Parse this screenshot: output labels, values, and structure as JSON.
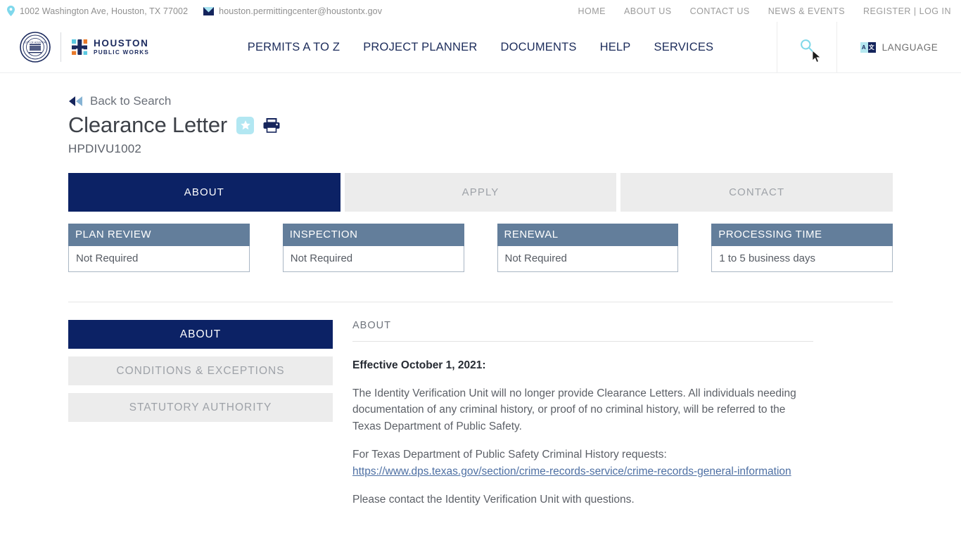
{
  "topbar": {
    "address": "1002 Washington Ave, Houston, TX 77002",
    "email": "houston.permittingcenter@houstontx.gov",
    "address_icon": "map-pin-icon",
    "email_icon": "envelope-icon",
    "links": [
      {
        "label": "HOME"
      },
      {
        "label": "ABOUT US"
      },
      {
        "label": "CONTACT US"
      },
      {
        "label": "NEWS & EVENTS"
      },
      {
        "label": "REGISTER | LOG IN"
      }
    ]
  },
  "header": {
    "seal_icon": "city-of-houston-seal-icon",
    "logo_mark_icon": "houston-public-works-mark-icon",
    "logo_line1": "HOUSTON",
    "logo_line2": "PUBLIC WORKS",
    "nav": [
      {
        "label": "PERMITS A TO Z"
      },
      {
        "label": "PROJECT PLANNER"
      },
      {
        "label": "DOCUMENTS"
      },
      {
        "label": "HELP"
      },
      {
        "label": "SERVICES"
      }
    ],
    "search_icon": "search-icon",
    "language_label": "LANGUAGE",
    "language_icon": "translate-icon",
    "language_icon_left_char": "A",
    "language_icon_right_char": "文"
  },
  "main": {
    "back_link": "Back to Search",
    "back_icon": "back-arrow-icon",
    "title": "Clearance Letter",
    "favorite_icon": "star-icon",
    "print_icon": "printer-icon",
    "permit_code": "HPDIVU1002",
    "tabs": [
      {
        "label": "ABOUT",
        "active": true
      },
      {
        "label": "APPLY",
        "active": false
      },
      {
        "label": "CONTACT",
        "active": false
      }
    ],
    "cards": [
      {
        "heading": "PLAN REVIEW",
        "value": "Not Required"
      },
      {
        "heading": "INSPECTION",
        "value": "Not Required"
      },
      {
        "heading": "RENEWAL",
        "value": "Not Required"
      },
      {
        "heading": "PROCESSING TIME",
        "value": "1 to 5 business days"
      }
    ],
    "side_nav": [
      {
        "label": "ABOUT",
        "active": true
      },
      {
        "label": "CONDITIONS & EXCEPTIONS",
        "active": false
      },
      {
        "label": "STATUTORY AUTHORITY",
        "active": false
      }
    ],
    "content": {
      "section_label": "ABOUT",
      "heading": "Effective October 1, 2021:",
      "paragraph1": "The Identity Verification Unit will no longer provide Clearance Letters. All individuals needing documentation of any criminal history, or proof of no criminal history, will be referred to the Texas Department of Public Safety.",
      "paragraph2_intro": "For Texas Department of Public Safety Criminal History requests:",
      "link_text": "https://www.dps.texas.gov/section/crime-records-service/crime-records-general-information",
      "paragraph3": "Please contact the Identity Verification Unit with questions."
    }
  },
  "colors": {
    "navy": "#0c2265",
    "slate": "#637e9b",
    "light_gray": "#ececec",
    "cyan": "#b2e7f2",
    "link": "#4d6fa3"
  }
}
